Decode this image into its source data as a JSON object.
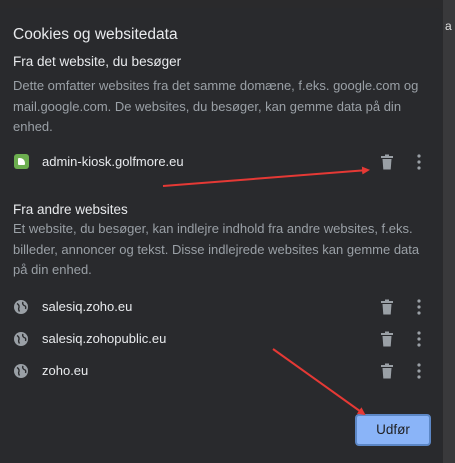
{
  "dialog": {
    "title": "Cookies og websitedata",
    "first_party": {
      "heading": "Fra det website, du besøger",
      "description": "Dette omfatter websites fra det samme domæne, f.eks. google.com og mail.google.com. De websites, du besøger, kan gemme data på din enhed.",
      "sites": [
        {
          "label": "admin-kiosk.golfmore.eu",
          "icon": "green-site-favicon"
        }
      ]
    },
    "third_party": {
      "heading": "Fra andre websites",
      "description": "Et website, du besøger, kan indlejre indhold fra andre websites, f.eks. billeder, annoncer og tekst. Disse indlejrede websites kan gemme data på din enhed.",
      "sites": [
        {
          "label": "salesiq.zoho.eu",
          "icon": "globe-icon"
        },
        {
          "label": "salesiq.zohopublic.eu",
          "icon": "globe-icon"
        },
        {
          "label": "zoho.eu",
          "icon": "globe-icon"
        }
      ]
    },
    "apply_button_label": "Udfør"
  },
  "background": {
    "edge_text": "a"
  },
  "colors": {
    "dialog_bg": "#292a2d",
    "primary_text": "#e8eaed",
    "secondary_text": "#9aa0a6",
    "icon_gray": "#9aa0a6",
    "button_bg": "#8ab4f8",
    "annotation_arrow": "#e53935"
  }
}
